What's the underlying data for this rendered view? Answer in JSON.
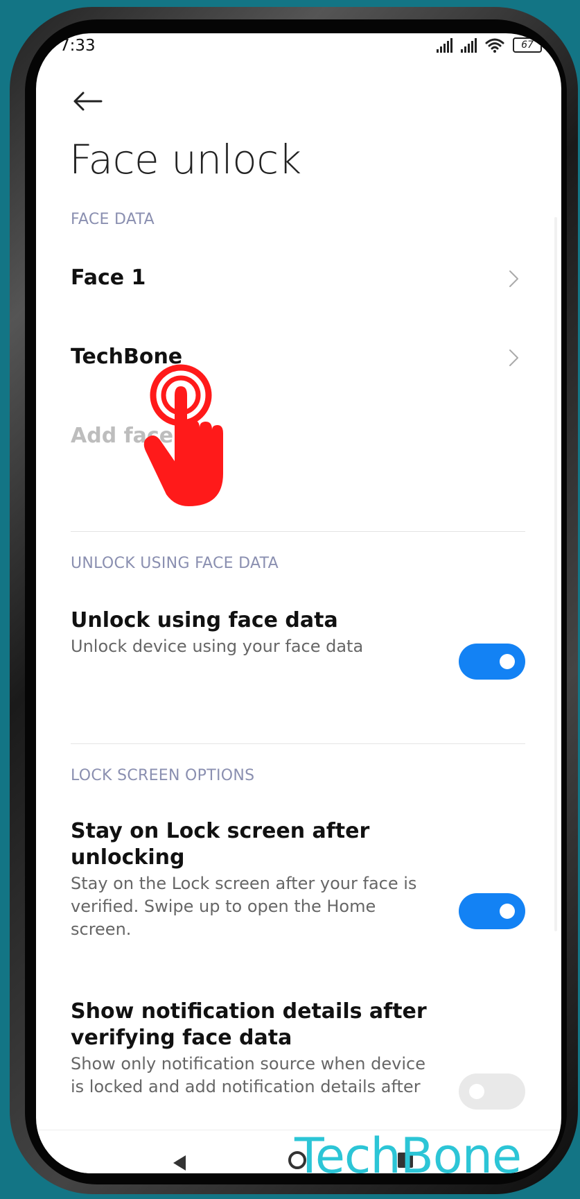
{
  "status": {
    "time": "7:33",
    "battery": "67"
  },
  "header": {
    "title": "Face unlock"
  },
  "sections": {
    "face_data": {
      "label": "FACE DATA",
      "items": [
        {
          "label": "Face 1"
        },
        {
          "label": "TechBone"
        }
      ],
      "add_label": "Add face"
    },
    "unlock": {
      "label": "UNLOCK USING FACE DATA",
      "title": "Unlock using face data",
      "subtitle": "Unlock device using your face data",
      "enabled": true
    },
    "lock_screen": {
      "label": "LOCK SCREEN OPTIONS",
      "stay_title": "Stay on Lock screen after unlocking",
      "stay_subtitle": "Stay on the Lock screen after your face is verified. Swipe up to open the Home screen.",
      "stay_enabled": true,
      "notif_title": "Show notification details after verifying face data",
      "notif_subtitle": "Show only notification source when device is locked and add notification details after",
      "notif_enabled": false
    }
  },
  "watermark": "TechBone",
  "colors": {
    "accent": "#1382f4",
    "section_label": "#8a8fb0",
    "background": "#137585",
    "tap_indicator": "#ff1a1a",
    "watermark": "#2cc5d6"
  },
  "icons": {
    "back": "arrow-left-icon",
    "chevron": "chevron-right-icon",
    "tap": "tap-hand-icon"
  }
}
